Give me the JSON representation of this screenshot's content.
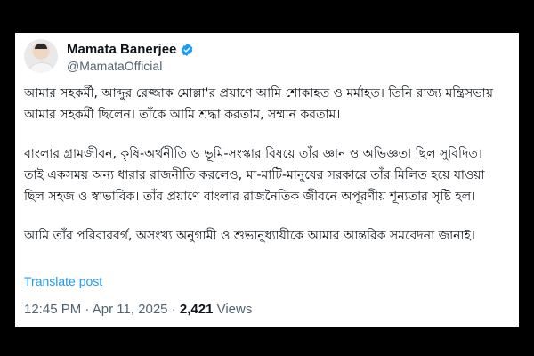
{
  "post": {
    "author_name": "Mamata Banerjee",
    "handle": "@MamataOfficial",
    "paragraphs": [
      "আমার সহকর্মী, আব্দুর রেজ্জাক মোল্লা'র প্রয়াণে আমি শোকাহত ও মর্মাহত। তিনি রাজ্য মন্ত্রিসভায় আমার সহকর্মী ছিলেন। তাঁকে আমি শ্রদ্ধা করতাম, সম্মান করতাম।",
      "বাংলার গ্রামজীবন, কৃষি-অর্থনীতি ও ভূমি-সংস্কার বিষয়ে তাঁর জ্ঞান ও অভিজ্ঞতা ছিল সুবিদিত। তাই একসময় অন্য ধারার রাজনীতি করলেও, মা-মাটি-মানুষের সরকারে তাঁর মিলিত হয়ে যাওয়া ছিল সহজ ও স্বাভাবিক। তাঁর প্রয়াণে বাংলার রাজনৈতিক জীবনে অপূরণীয় শূন্যতার সৃষ্টি হল।",
      "আমি তাঁর পরিবারবর্গ, অসংখ্য অনুগামী ও শুভানুধ্যায়ীকে আমার আন্তরিক সমবেদনা জানাই।"
    ],
    "translate_label": "Translate post",
    "time": "12:45 PM",
    "separator": " · ",
    "date": "Apr 11, 2025",
    "views_count": "2,421",
    "views_label": " Views"
  },
  "icons": {
    "verified": "verified-badge-icon"
  },
  "colors": {
    "accent": "#1d9bf0",
    "muted": "#536471",
    "text": "#0f1419"
  }
}
